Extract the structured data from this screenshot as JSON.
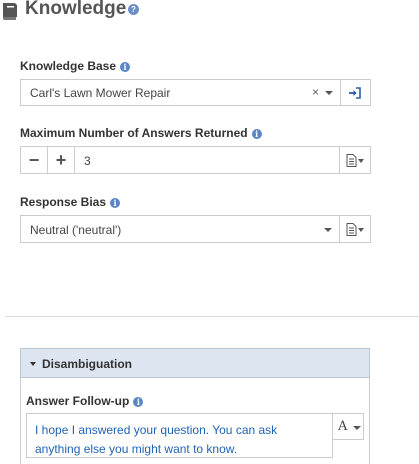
{
  "header": {
    "title": "Knowledge",
    "help_icon": "question-icon"
  },
  "knowledge_base": {
    "label": "Knowledge Base",
    "value": "Carl's Lawn Mower Repair",
    "clear_icon": "×",
    "open_icon": "sign-in-icon"
  },
  "max_answers": {
    "label": "Maximum Number of Answers Returned",
    "value": "3",
    "decrement": "−",
    "increment": "+"
  },
  "response_bias": {
    "label": "Response Bias",
    "value": "Neutral ('neutral')"
  },
  "disambiguation": {
    "title": "Disambiguation",
    "followup_label": "Answer Follow-up",
    "followup_text": "I hope I answered your question. You can ask anything else you might want to know.",
    "font_button": "A"
  },
  "colors": {
    "accent_blue": "#5b86c6",
    "link_text": "#1f63b5",
    "panel_bg": "#dde6f0"
  }
}
